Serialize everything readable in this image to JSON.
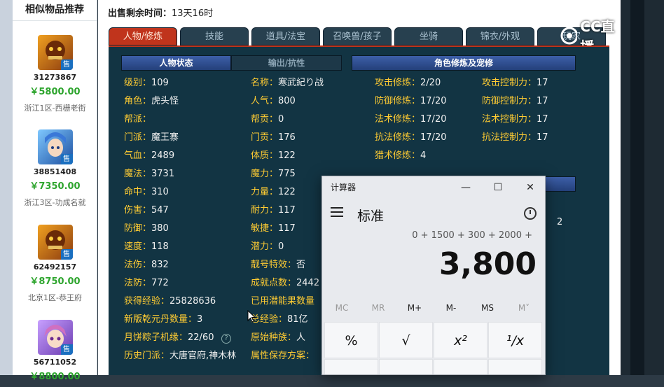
{
  "sidebar": {
    "title": "相似物品推荐",
    "items": [
      {
        "id": "31273867",
        "price": "￥5800.00",
        "server": "浙江1区-西栅老街",
        "badge": "售"
      },
      {
        "id": "38851408",
        "price": "￥7350.00",
        "server": "浙江3区-功成名就",
        "badge": "售"
      },
      {
        "id": "62492157",
        "price": "￥8750.00",
        "server": "北京1区-恭王府",
        "badge": "售"
      },
      {
        "id": "56711052",
        "price": "￥8800.00",
        "server": "",
        "badge": "售"
      }
    ]
  },
  "header": {
    "time_label": "出售剩余时间：",
    "time_value": "13天16时"
  },
  "tabs": [
    "人物/修炼",
    "技能",
    "道具/法宝",
    "召唤兽/孩子",
    "坐骑",
    "锦衣/外观",
    "玩家"
  ],
  "watermark": "CC直播",
  "sections": {
    "status": "人物状态",
    "output": "输出/抗性",
    "cultivation": "角色修炼及宠修"
  },
  "col1": [
    {
      "label": "级别：",
      "value": "109"
    },
    {
      "label": "角色：",
      "value": "虎头怪"
    },
    {
      "label": "帮派：",
      "value": ""
    },
    {
      "label": "门派：",
      "value": "魔王寨"
    },
    {
      "label": "气血：",
      "value": "2489"
    },
    {
      "label": "魔法：",
      "value": "3731"
    },
    {
      "label": "命中：",
      "value": "310"
    },
    {
      "label": "伤害：",
      "value": "547"
    },
    {
      "label": "防御：",
      "value": "380"
    },
    {
      "label": "速度：",
      "value": "118"
    },
    {
      "label": "法伤：",
      "value": "832"
    },
    {
      "label": "法防：",
      "value": "772"
    },
    {
      "label": "获得经验：",
      "value": "25828636"
    },
    {
      "label": "新版乾元丹数量：",
      "value": "3"
    },
    {
      "label": "月饼粽子机缘：",
      "value": "22/60"
    },
    {
      "label": "历史门派：",
      "value": "大唐官府,神木林"
    }
  ],
  "col2": [
    {
      "label": "名称：",
      "value": "寒武紀り战"
    },
    {
      "label": "人气：",
      "value": "800"
    },
    {
      "label": "帮贡：",
      "value": "0"
    },
    {
      "label": "门贡：",
      "value": "176"
    },
    {
      "label": "体质：",
      "value": "122"
    },
    {
      "label": "魔力：",
      "value": "775"
    },
    {
      "label": "力量：",
      "value": "122"
    },
    {
      "label": "耐力：",
      "value": "117"
    },
    {
      "label": "敏捷：",
      "value": "117"
    },
    {
      "label": "潜力：",
      "value": "0"
    },
    {
      "label": "靓号特效：",
      "value": "否"
    },
    {
      "label": "成就点数：",
      "value": "2442"
    },
    {
      "label": "已用潜能果数量",
      "value": ""
    },
    {
      "label": "总经验：",
      "value": "81亿"
    },
    {
      "label": "原始种族：",
      "value": "人"
    },
    {
      "label": "属性保存方案：",
      "value": ""
    }
  ],
  "col3": [
    {
      "label": "攻击修炼：",
      "value": "2/20"
    },
    {
      "label": "防御修炼：",
      "value": "17/20"
    },
    {
      "label": "法术修炼：",
      "value": "17/20"
    },
    {
      "label": "抗法修炼：",
      "value": "17/20"
    },
    {
      "label": "猎术修炼：",
      "value": "4"
    }
  ],
  "col4": [
    {
      "label": "攻击控制力：",
      "value": "17"
    },
    {
      "label": "防御控制力：",
      "value": "17"
    },
    {
      "label": "法术控制力：",
      "value": "17"
    },
    {
      "label": "抗法控制力：",
      "value": "17"
    }
  ],
  "partial_value": "2",
  "calculator": {
    "title": "计算器",
    "mode": "标准",
    "expression": "0 + 1500 + 300 + 2000 +",
    "result": "3,800",
    "memory": [
      "MC",
      "MR",
      "M+",
      "M-",
      "MS",
      "M˅"
    ],
    "keys": [
      "%",
      "√",
      "x²",
      "¹/x"
    ]
  }
}
